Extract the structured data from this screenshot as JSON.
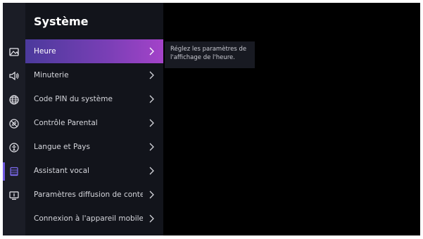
{
  "rail": {
    "icons": [
      "picture-icon",
      "speaker-icon",
      "globe-icon",
      "no-signal-icon",
      "accessibility-icon",
      "system-list-icon",
      "info-tv-icon"
    ]
  },
  "menu": {
    "title": "Système",
    "items": [
      {
        "label": "Heure"
      },
      {
        "label": "Minuterie"
      },
      {
        "label": "Code PIN du système"
      },
      {
        "label": "Contrôle Parental"
      },
      {
        "label": "Langue et Pays"
      },
      {
        "label": "Assistant vocal"
      },
      {
        "label": "Paramètres diffusion de conte..."
      },
      {
        "label": "Connexion à l'appareil mobile"
      }
    ],
    "selected": "Heure"
  },
  "tooltip": {
    "text": "Réglez les paramètres de l'affichage de l'heure."
  },
  "colors": {
    "accent": "#7a3fb6",
    "rail_active": "#6f58e0"
  }
}
